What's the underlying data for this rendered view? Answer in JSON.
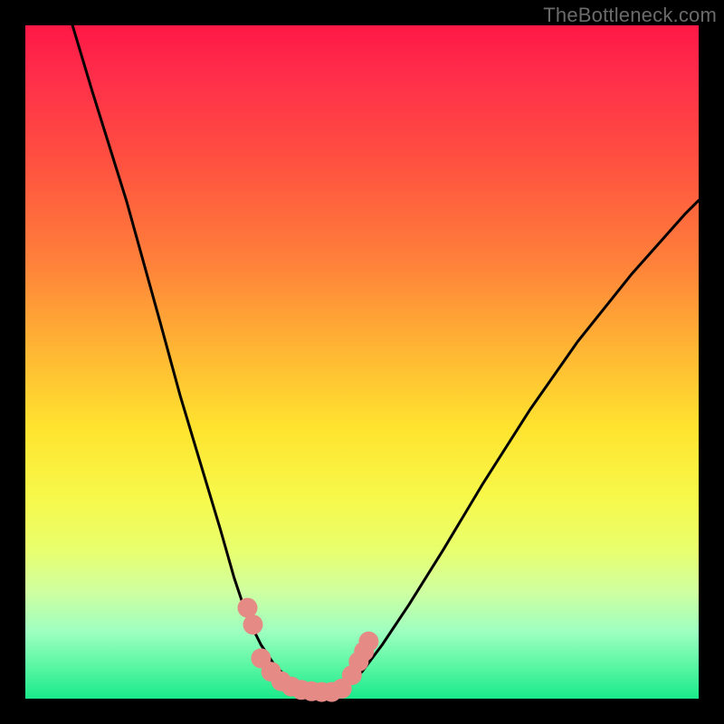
{
  "watermark": "TheBottleneck.com",
  "chart_data": {
    "type": "line",
    "title": "",
    "xlabel": "",
    "ylabel": "",
    "xlim": [
      0,
      100
    ],
    "ylim": [
      0,
      100
    ],
    "grid": false,
    "legend": false,
    "series": [
      {
        "name": "left-curve",
        "x": [
          7,
          10,
          15,
          20,
          23,
          26,
          29,
          31,
          33,
          35,
          37,
          40,
          43,
          46
        ],
        "values": [
          100,
          90,
          74,
          56,
          45,
          35,
          25,
          18,
          12,
          8,
          5,
          2,
          1,
          1
        ]
      },
      {
        "name": "right-curve",
        "x": [
          46,
          48,
          50,
          53,
          57,
          62,
          68,
          75,
          82,
          90,
          98,
          100
        ],
        "values": [
          1,
          2,
          4,
          8,
          14,
          22,
          32,
          43,
          53,
          63,
          72,
          74
        ]
      }
    ],
    "markers": {
      "name": "salmon-dots",
      "color": "#e68a86",
      "points": [
        {
          "x": 33.0,
          "y": 13.5
        },
        {
          "x": 33.8,
          "y": 11.0
        },
        {
          "x": 35.0,
          "y": 6.0
        },
        {
          "x": 36.5,
          "y": 4.0
        },
        {
          "x": 38.0,
          "y": 2.6
        },
        {
          "x": 39.5,
          "y": 1.8
        },
        {
          "x": 41.0,
          "y": 1.3
        },
        {
          "x": 42.5,
          "y": 1.1
        },
        {
          "x": 44.0,
          "y": 1.0
        },
        {
          "x": 45.5,
          "y": 1.0
        },
        {
          "x": 47.0,
          "y": 1.5
        },
        {
          "x": 48.5,
          "y": 3.5
        },
        {
          "x": 49.5,
          "y": 5.5
        },
        {
          "x": 50.3,
          "y": 7.0
        },
        {
          "x": 51.0,
          "y": 8.5
        }
      ]
    },
    "gradient_stops": [
      {
        "pos": 0.0,
        "color": "#ff1846"
      },
      {
        "pos": 0.6,
        "color": "#ffe42f"
      },
      {
        "pos": 1.0,
        "color": "#1ae98b"
      }
    ]
  }
}
